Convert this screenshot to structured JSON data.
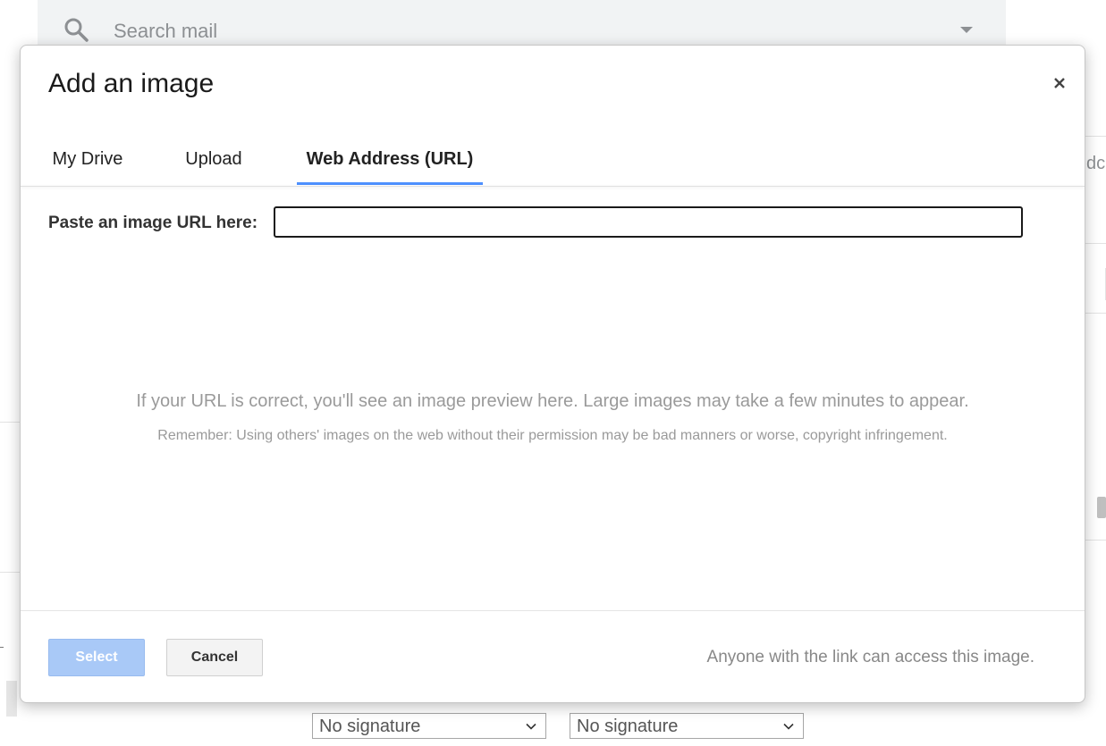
{
  "background": {
    "search": {
      "placeholder": "Search mail"
    },
    "partial_text": "dc",
    "signatures": [
      {
        "value": "No signature"
      },
      {
        "value": "No signature"
      }
    ]
  },
  "dialog": {
    "title": "Add an image",
    "close_label": "×",
    "tabs": [
      {
        "label": "My Drive",
        "active": false
      },
      {
        "label": "Upload",
        "active": false
      },
      {
        "label": "Web Address (URL)",
        "active": true
      }
    ],
    "url_label": "Paste an image URL here:",
    "url_value": "",
    "preview_message": "If your URL is correct, you'll see an image preview here. Large images may take a few minutes to appear.",
    "preview_note": "Remember: Using others' images on the web without their permission may be bad manners or worse, copyright infringement.",
    "select_label": "Select",
    "cancel_label": "Cancel",
    "access_note": "Anyone with the link can access this image."
  },
  "colors": {
    "tab_indicator": "#4d90fe",
    "select_button_disabled": "#a9c9f7"
  }
}
